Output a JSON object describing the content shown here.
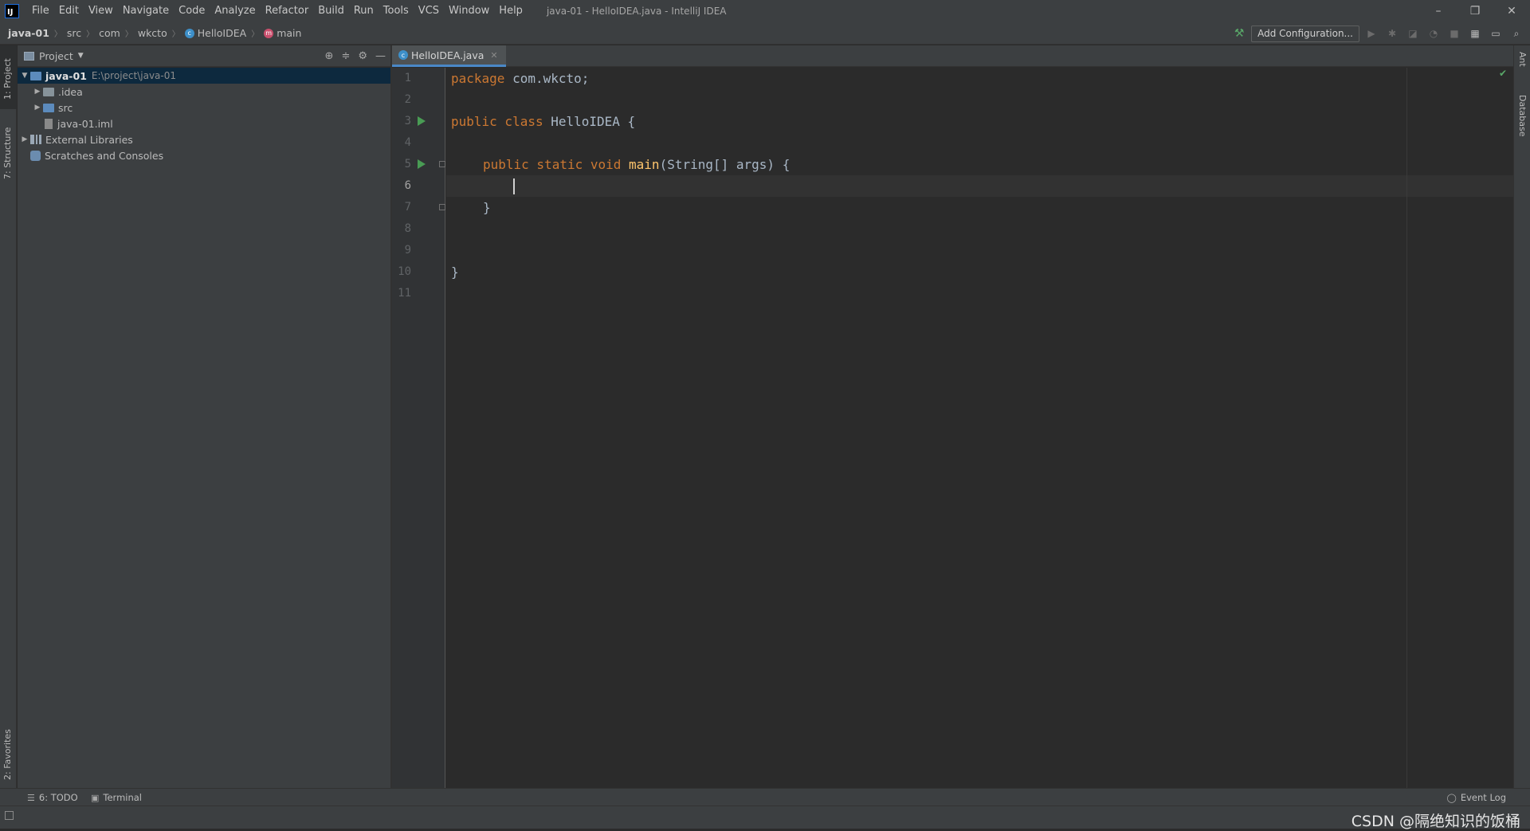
{
  "window": {
    "logo_text": "IJ",
    "title": "java-01 - HelloIDEA.java - IntelliJ IDEA",
    "controls": [
      "–",
      "❐",
      "✕"
    ]
  },
  "menu": [
    "File",
    "Edit",
    "View",
    "Navigate",
    "Code",
    "Analyze",
    "Refactor",
    "Build",
    "Run",
    "Tools",
    "VCS",
    "Window",
    "Help"
  ],
  "breadcrumb": {
    "project": "java-01",
    "items": [
      "src",
      "com",
      "wkcto"
    ],
    "class_name": "HelloIDEA",
    "method_name": "main"
  },
  "toolbar": {
    "add_configuration": "Add Configuration..."
  },
  "left_tabs": {
    "project": "1: Project",
    "structure": "7: Structure",
    "favorites": "2: Favorites"
  },
  "right_tabs": {
    "ant": "Ant",
    "database": "Database"
  },
  "project_panel": {
    "title": "Project",
    "tree": [
      {
        "label": "java-01",
        "hint": "E:\\project\\java-01"
      },
      {
        "label": ".idea"
      },
      {
        "label": "src"
      },
      {
        "label": "java-01.iml"
      },
      {
        "label": "External Libraries"
      },
      {
        "label": "Scratches and Consoles"
      }
    ]
  },
  "editor": {
    "tab_label": "HelloIDEA.java",
    "line_numbers": [
      "1",
      "2",
      "3",
      "4",
      "5",
      "6",
      "7",
      "8",
      "9",
      "10",
      "11"
    ],
    "current_line": 6,
    "code": {
      "l1_kw": "package",
      "l1_rest": " com.wkcto;",
      "l3_kw": "public class",
      "l3_rest": " HelloIDEA {",
      "l5_kw": "public static void",
      "l5_fn": "main",
      "l5_rest": "(String[] args) {",
      "l7": "}",
      "l10": "}"
    }
  },
  "bottom_tabs": {
    "todo": "6: TODO",
    "terminal": "Terminal",
    "event_log": "Event Log"
  },
  "status": {
    "watermark": "CSDN @隔绝知识的饭桶"
  }
}
